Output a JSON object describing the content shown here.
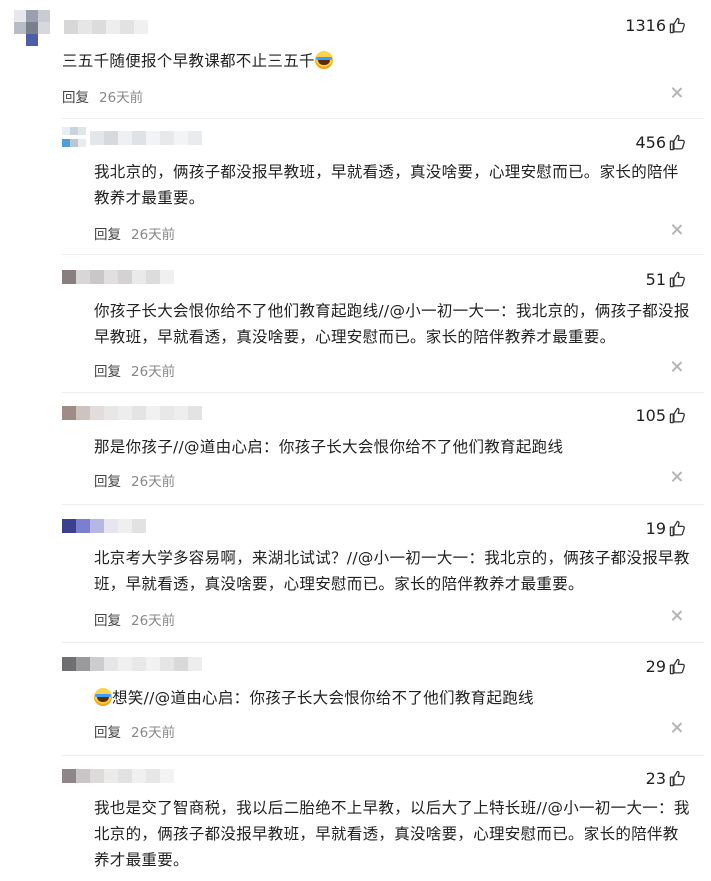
{
  "comments": [
    {
      "likes": "1316",
      "text": "三五千随便报个早教课都不止三五千",
      "emoji": true,
      "reply_label": "回复",
      "time": "26天前"
    },
    {
      "likes": "456",
      "text": "我北京的，俩孩子都没报早教班，早就看透，真没啥要，心理安慰而已。家长的陪伴教养才最重要。",
      "reply_label": "回复",
      "time": "26天前"
    },
    {
      "likes": "51",
      "text": "你孩子长大会恨你给不了他们教育起跑线//@小一初一大一：我北京的，俩孩子都没报早教班，早就看透，真没啥要，心理安慰而已。家长的陪伴教养才最重要。",
      "reply_label": "回复",
      "time": "26天前"
    },
    {
      "likes": "105",
      "text": "那是你孩子//@道由心启：你孩子长大会恨你给不了他们教育起跑线",
      "reply_label": "回复",
      "time": "26天前"
    },
    {
      "likes": "19",
      "text": "北京考大学多容易啊，来湖北试试？//@小一初一大一：我北京的，俩孩子都没报早教班，早就看透，真没啥要，心理安慰而已。家长的陪伴教养才最重要。",
      "reply_label": "回复",
      "time": "26天前"
    },
    {
      "likes": "29",
      "text": "想笑//@道由心启：你孩子长大会恨你给不了他们教育起跑线",
      "emoji_prefix": true,
      "reply_label": "回复",
      "time": "26天前"
    },
    {
      "likes": "23",
      "text": "我也是交了智商税，我以后二胎绝不上早教，以后大了上特长班//@小一初一大一：我北京的，俩孩子都没报早教班，早就看透，真没啥要，心理安慰而已。家长的陪伴教养才最重要。",
      "reply_label": "回复",
      "time": ""
    }
  ],
  "icons": {
    "like": "thumbs-up-icon",
    "close": "close-icon"
  },
  "colors": {
    "divider": "#eeeeee",
    "meta": "#888888",
    "text": "#222222"
  }
}
